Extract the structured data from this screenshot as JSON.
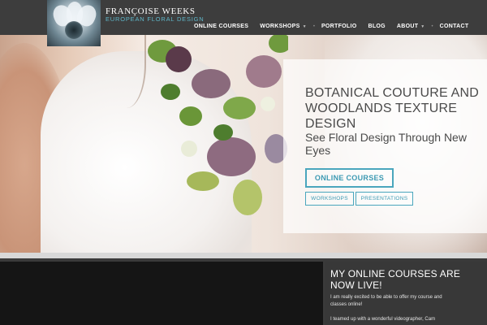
{
  "header": {
    "brand_name": "FRANÇOISE WEEKS",
    "brand_tagline": "EUROPEAN FLORAL DESIGN"
  },
  "nav": {
    "items": [
      {
        "label": "ONLINE COURSES"
      },
      {
        "label": "WORKSHOPS"
      },
      {
        "label": "PORTFOLIO"
      },
      {
        "label": "BLOG"
      },
      {
        "label": "ABOUT"
      },
      {
        "label": "CONTACT"
      }
    ],
    "separator": "•",
    "caret": "▼"
  },
  "hero": {
    "title": "BOTANICAL COUTURE AND WOODLANDS TEXTURE DESIGN",
    "subtitle": "See Floral Design Through New Eyes",
    "primary_button": "ONLINE COURSES",
    "secondary_buttons": [
      "WORKSHOPS",
      "PRESENTATIONS"
    ]
  },
  "sidebar_post": {
    "title": "MY ONLINE COURSES ARE NOW LIVE!",
    "paragraph1": "I am really excited to be able to offer my course and classes online!",
    "paragraph2": "I teamed up with a wonderful videographer, Cam"
  },
  "colors": {
    "accent": "#4aa6bd",
    "header_bg": "#3d3d3d",
    "tagline": "#5fb6c8"
  }
}
